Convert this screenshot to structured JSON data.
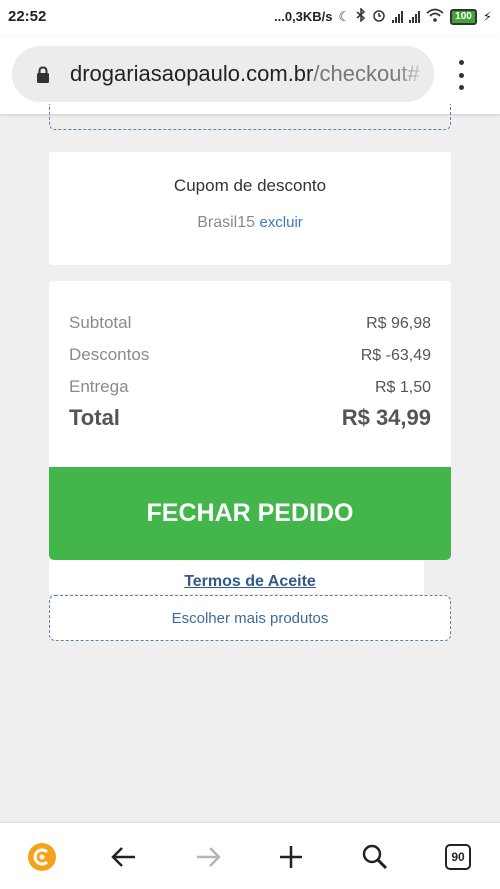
{
  "status_bar": {
    "time": "22:52",
    "network_speed": "...0,3KB/s",
    "battery": "100"
  },
  "browser": {
    "url_domain": "drogariasaopaulo.com.br",
    "url_path": "/checkout#",
    "tab_count": "90"
  },
  "coupon": {
    "title": "Cupom de desconto",
    "code": "Brasil15",
    "remove_label": "excluir"
  },
  "summary": {
    "rows": [
      {
        "label": "Subtotal",
        "value": "R$ 96,98"
      },
      {
        "label": "Descontos",
        "value": "R$ -63,49"
      },
      {
        "label": "Entrega",
        "value": "R$ 1,50"
      }
    ],
    "total_label": "Total",
    "total_value": "R$ 34,99"
  },
  "actions": {
    "checkout_label": "FECHAR PEDIDO",
    "terms_label": "Termos de Aceite",
    "more_products_label": "Escolher mais produtos"
  },
  "colors": {
    "checkout_green": "#42b64a",
    "link_blue": "#3b78c2",
    "logo_orange": "#f7a21b"
  },
  "icons": [
    "lock-icon",
    "menu-icon",
    "browser-logo-icon",
    "back-arrow-icon",
    "forward-arrow-icon",
    "new-tab-icon",
    "search-icon",
    "tab-count-icon"
  ]
}
